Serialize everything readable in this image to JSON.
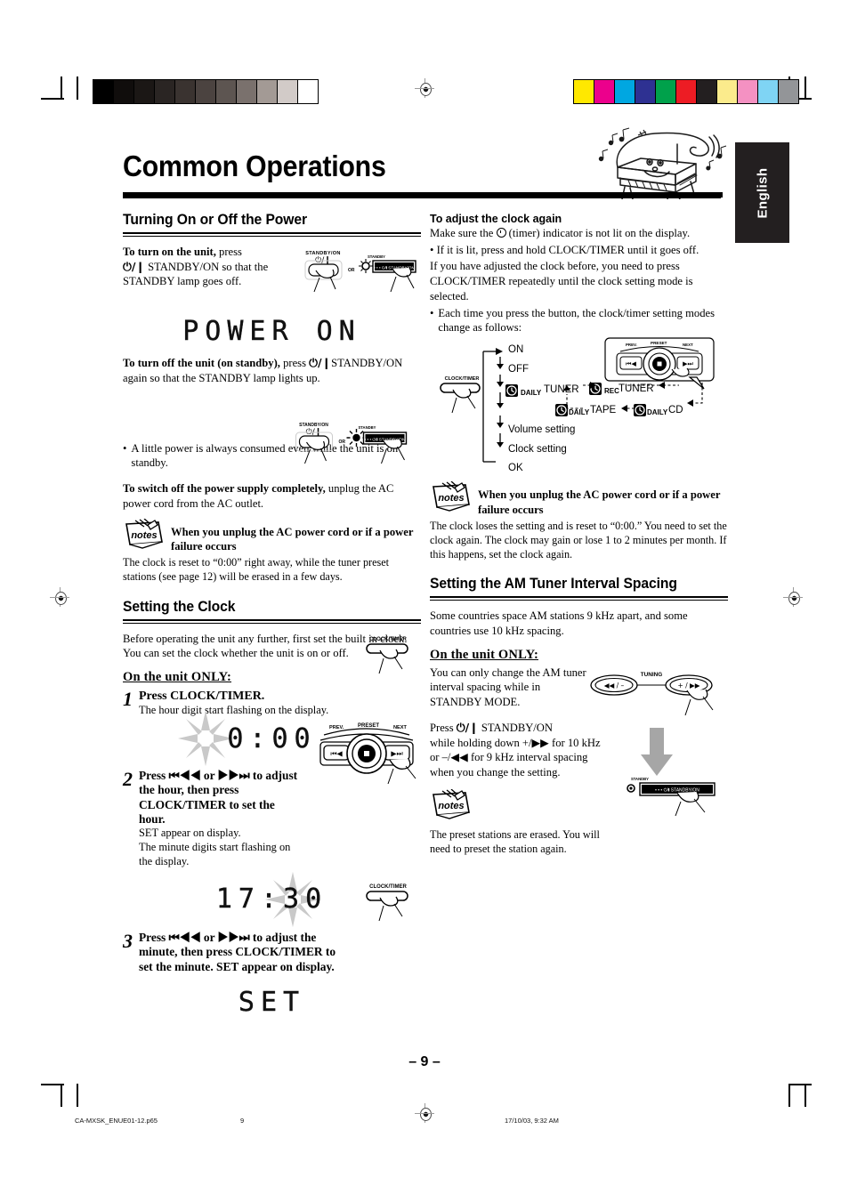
{
  "page": {
    "title": "Common Operations",
    "language_tab": "English",
    "page_number": "– 9 –",
    "colophon_file": "CA-MXSK_ENUE01-12.p65",
    "colophon_page": "9",
    "colophon_date": "17/10/03, 9:32 AM"
  },
  "calibration": {
    "gray_bar": [
      "#000000",
      "#100d0c",
      "#1b1715",
      "#2a2523",
      "#3a3330",
      "#4b4340",
      "#5d5551",
      "#7a716d",
      "#a39a95",
      "#d2cbc8",
      "#ffffff"
    ],
    "color_bar": [
      "#ffe800",
      "#ec008c",
      "#00a7e1",
      "#2e3192",
      "#00a14b",
      "#ed1c24",
      "#231f20",
      "#fbeb8c",
      "#f491c2",
      "#7fd4f4",
      "#939598"
    ]
  },
  "left_column": {
    "section_title": "Turning On or Off the Power",
    "turn_on": {
      "lead": "To turn on the unit,",
      "rest": "press",
      "line2_pre": "STANDBY/ON so that the",
      "line3": "STANDBY lamp goes off."
    },
    "lcd_power_on": "POWER ON",
    "turn_off": {
      "lead": "To turn off the unit (on standby),",
      "rest": "press",
      "tail": "STANDBY/ON",
      "line2": "again so that the STANDBY lamp lights up."
    },
    "bullet_standby": "A little power is always consumed even while the unit is on standby.",
    "switch_off": {
      "lead": "To switch off the power supply completely,",
      "rest": "unplug the AC",
      "line2": "power cord from the AC outlet."
    },
    "note1": {
      "icon_label": "notes",
      "heading": "When you unplug the AC power cord or if a power failure occurs",
      "body": "The clock is reset to “0:00” right away, while the tuner preset stations (see page 12) will be erased in a few days."
    },
    "clock_section_title": "Setting the Clock",
    "clock_intro": "Before operating the unit any further, first set the built in clock. You can set the clock whether the unit is on or off.",
    "on_unit_only": "On the unit ONLY:",
    "steps": [
      {
        "number": "1",
        "lead": "Press CLOCK/TIMER.",
        "desc": "The hour digit start flashing on the display.",
        "lcd": "0:00"
      },
      {
        "number": "2",
        "lead": "Press ⏮◀◀ or ▶▶⏭ to adjust the hour, then press CLOCK/TIMER to set the hour.",
        "desc": "SET appear on display.",
        "desc2": "The minute digits start flashing on the display.",
        "lcd": "17:30"
      },
      {
        "number": "3",
        "lead": "Press ⏮◀◀ or ▶▶⏭ to adjust the minute, then press CLOCK/TIMER to set the minute. SET appear on display.",
        "desc": "",
        "lcd": "SET"
      }
    ]
  },
  "right_column": {
    "adjust_again": {
      "heading": "To adjust the clock again",
      "line1_pre": "Make sure the",
      "line1_post": "(timer) indicator is not lit on the display.",
      "bullet1": "If it is lit, press and hold CLOCK/TIMER until it goes off.",
      "para": "If you have adjusted the clock before, you need to press CLOCK/TIMER repeatedly until the clock setting mode is selected.",
      "bullet2": "Each time you press the button, the clock/timer setting modes change as follows:"
    },
    "flow": {
      "button_label": "CLOCK/TIMER",
      "items": [
        "ON",
        "OFF",
        "DAILY TUNER",
        "Volume setting",
        "Clock setting",
        "OK"
      ],
      "branch": [
        "REC TUNER",
        "DAILY CD",
        "DAILY TAPE"
      ],
      "daily_tag": "DAILY",
      "rec_tag": "REC"
    },
    "note2": {
      "icon_label": "notes",
      "heading": "When you unplug the AC power cord or if a power failure occurs",
      "body": "The clock loses the setting and is reset to “0:00.” You need to set the clock again. The clock may gain or lose 1 to 2 minutes per month. If this happens, set the clock again."
    },
    "am_section_title": "Setting the AM Tuner Interval Spacing",
    "am_intro": "Some countries space AM stations 9 kHz apart, and some countries use 10 kHz spacing.",
    "on_unit_only": "On the unit ONLY:",
    "am_body1": "You can only change the AM tuner interval spacing while in STANDBY MODE.",
    "am_body2": {
      "line1_pre": "Press",
      "line1_post": "STANDBY/ON",
      "line2": "while holding down +/▶▶  for 10 kHz",
      "line3": "or  –/◀◀  for 9 kHz interval spacing",
      "line4": "when you change the setting."
    },
    "note3": {
      "icon_label": "notes",
      "body": "The preset stations are erased. You will need to preset the station again."
    }
  },
  "illustrations": {
    "remote_standby_label": "STANDBY/ON",
    "or_label": "OR",
    "unit_standby_label": "STANDBY",
    "unit_button_text": "STANDBY/ON",
    "clock_timer_label": "CLOCK/TIMER",
    "jog_prev": "PREV.",
    "jog_preset": "PRESET",
    "jog_next": "NEXT",
    "tuning_label": "TUNING",
    "tuning_left": "◀◀ / –",
    "tuning_right": "+ / ▶▶"
  }
}
